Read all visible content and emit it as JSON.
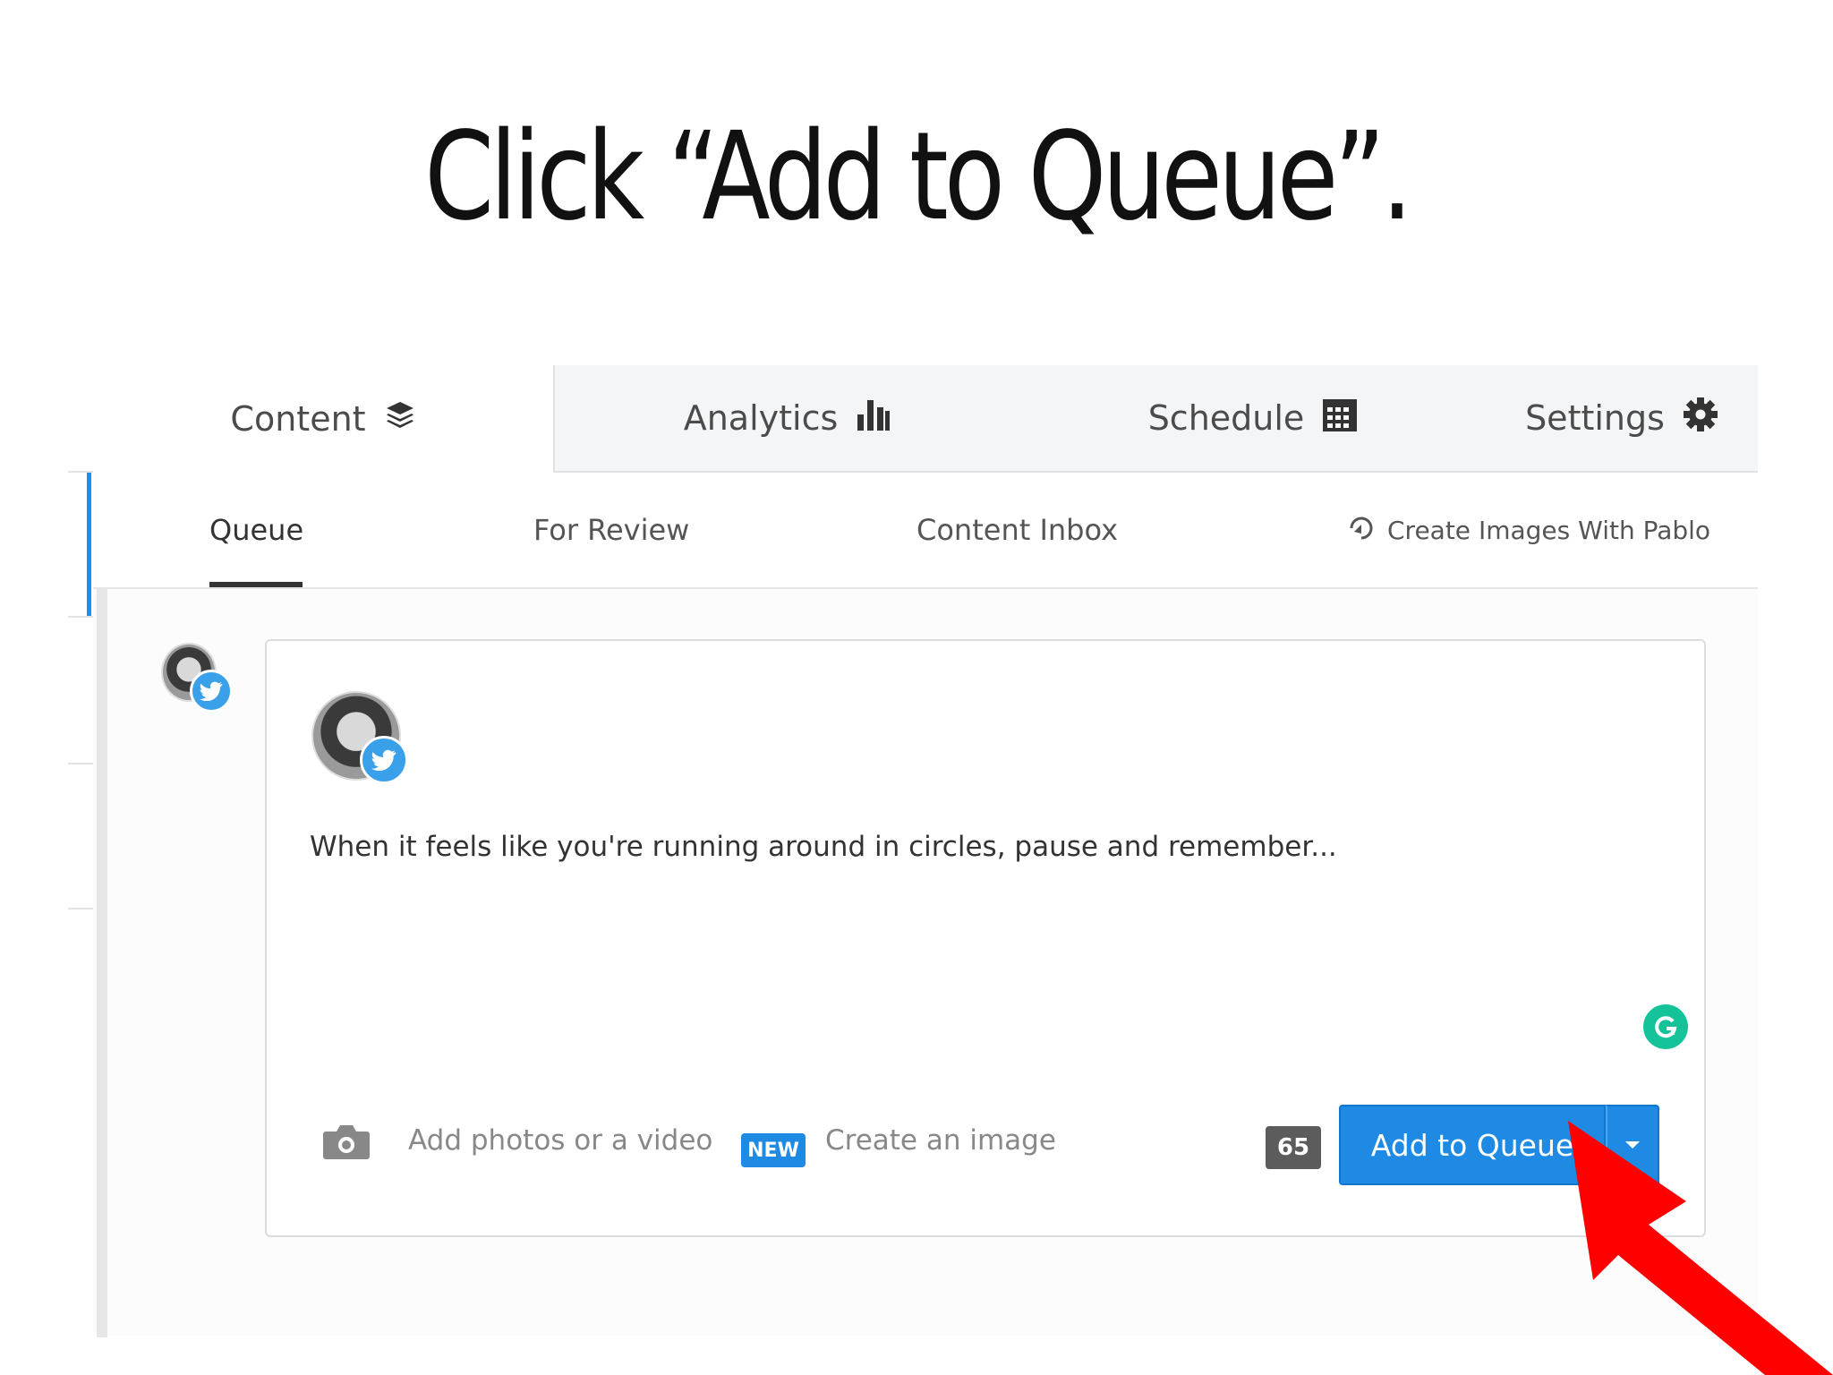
{
  "slide": {
    "title": "Click “Add to Queue”."
  },
  "main_tabs": [
    {
      "label": "Content",
      "icon": "layers-icon"
    },
    {
      "label": "Analytics",
      "icon": "bar-chart-icon"
    },
    {
      "label": "Schedule",
      "icon": "calendar-icon"
    },
    {
      "label": "Settings",
      "icon": "gear-icon"
    }
  ],
  "sub_tabs": [
    {
      "label": "Queue"
    },
    {
      "label": "For Review"
    },
    {
      "label": "Content Inbox"
    },
    {
      "label": "Create Images With Pablo",
      "icon": "pablo-icon"
    }
  ],
  "composer": {
    "text": "When it feels like you're running around in circles, pause and remember...",
    "add_media_label": "Add photos or a video",
    "new_badge": "NEW",
    "create_image_label": "Create an image",
    "char_count": "65",
    "submit_label": "Add to Queue"
  },
  "colors": {
    "accent": "#1e8ae3",
    "twitter": "#3aa0ea",
    "grammarly": "#15c39a",
    "arrow": "#ff0000"
  }
}
